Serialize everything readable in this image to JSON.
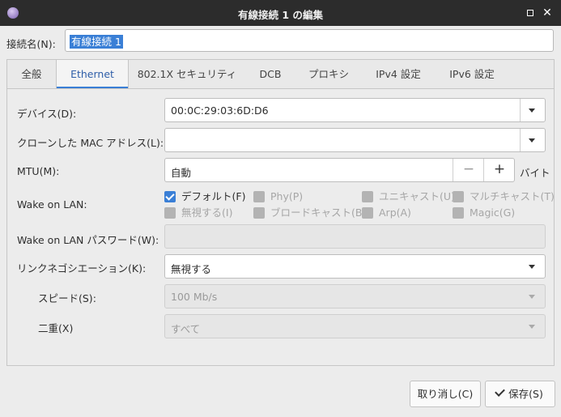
{
  "window": {
    "title": "有線接続 1 の編集",
    "close": "✕"
  },
  "connection": {
    "label": "接続名(N):",
    "value": "有線接続 1"
  },
  "tabs": [
    "全般",
    "Ethernet",
    "802.1X セキュリティ",
    "DCB",
    "プロキシ",
    "IPv4 設定",
    "IPv6 設定"
  ],
  "active_tab": "Ethernet",
  "form": {
    "device": {
      "label": "デバイス(D):",
      "value": "00:0C:29:03:6D:D6"
    },
    "cloned_mac": {
      "label": "クローンした MAC アドレス(L):",
      "value": ""
    },
    "mtu": {
      "label": "MTU(M):",
      "value": "自動",
      "minus": "−",
      "plus": "+",
      "unit": "バイト"
    },
    "wol": {
      "label": "Wake on LAN:",
      "options": [
        {
          "label": "デフォルト(F)",
          "checked": true,
          "enabled": true
        },
        {
          "label": "Phy(P)",
          "checked": false,
          "enabled": false
        },
        {
          "label": "ユニキャスト(U)",
          "checked": false,
          "enabled": false
        },
        {
          "label": "マルチキャスト(T)",
          "checked": false,
          "enabled": false
        },
        {
          "label": "無視する(I)",
          "checked": false,
          "enabled": false
        },
        {
          "label": "ブロードキャスト(B)",
          "checked": false,
          "enabled": false
        },
        {
          "label": "Arp(A)",
          "checked": false,
          "enabled": false
        },
        {
          "label": "Magic(G)",
          "checked": false,
          "enabled": false
        }
      ]
    },
    "wol_password": {
      "label": "Wake on LAN パスワード(W):",
      "value": ""
    },
    "link_negotiation": {
      "label": "リンクネゴシエーション(K):",
      "value": "無視する"
    },
    "speed": {
      "label": "スピード(S):",
      "value": "100 Mb/s"
    },
    "duplex": {
      "label": "二重(X)",
      "value": "すべて"
    }
  },
  "buttons": {
    "cancel": "取り消し(C)",
    "save": "保存(S)"
  },
  "colors": {
    "accent": "#3a7fd6",
    "titlebar": "#2c2c2c"
  }
}
